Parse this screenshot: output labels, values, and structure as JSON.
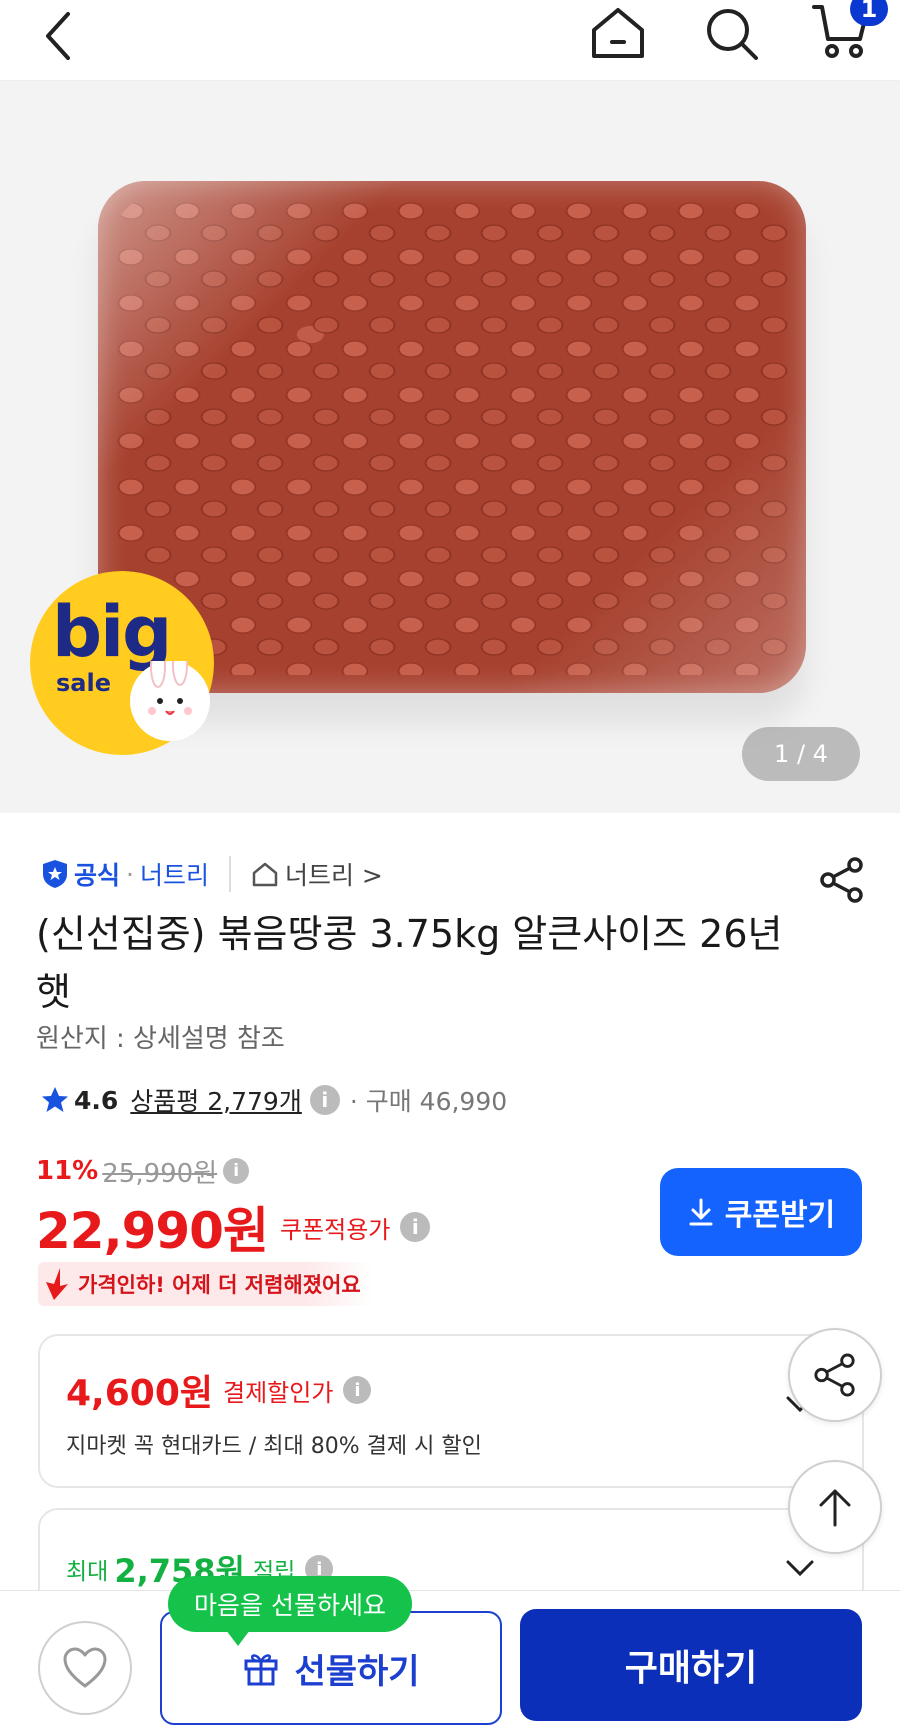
{
  "header": {
    "back_icon": "chevron-left-icon",
    "home_icon": "home-icon",
    "search_icon": "search-icon",
    "cart_icon": "cart-icon",
    "cart_count": "1",
    "badge_color": "#0b38d1"
  },
  "gallery": {
    "badge_big": "big",
    "badge_sale": "sale",
    "counter": "1 / 4"
  },
  "product": {
    "official_label": "공식",
    "seller": "너트리",
    "store_link": "너트리 >",
    "title": "(신선집중) 볶음땅콩 3.75kg 알큰사이즈 26년 햇",
    "origin": "원산지 : 상세설명 참조",
    "rating": "4.6",
    "reviews_label": "상품평 2,779개",
    "purchases": "· 구매 46,990"
  },
  "price": {
    "discount_rate": "11%",
    "original_price": "25,990원",
    "sale_price": "22,990원",
    "coupon_note": "쿠폰적용가",
    "coupon_button": "쿠폰받기",
    "price_drop_msg": "가격인하! 어제 더 저렴해졌어요",
    "accent_color": "#e8191b",
    "primary_color": "#1463ff"
  },
  "benefits": {
    "card_discount_amount": "4,600원",
    "card_discount_label": "결제할인가",
    "card_discount_desc": "지마켓 꼭 현대카드 / 최대 80% 결제 시 할인",
    "points_prefix": "최대",
    "points_amount": "2,758원",
    "points_suffix": "적립",
    "points_color": "#13b042"
  },
  "bottom_bar": {
    "gift_tooltip": "마음을 선물하세요",
    "gift_button": "선물하기",
    "buy_button": "구매하기",
    "buy_color": "#0b2fb8"
  }
}
